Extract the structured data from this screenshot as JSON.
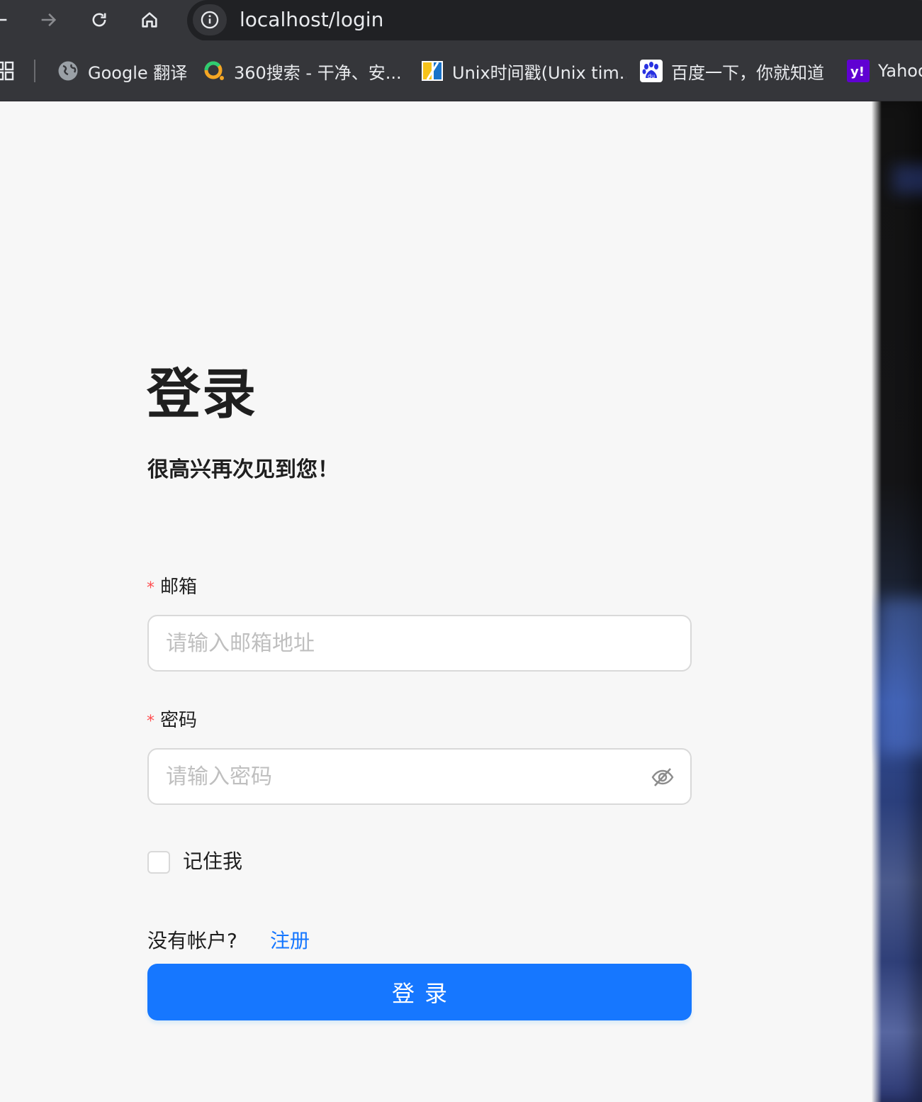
{
  "browser": {
    "url": "localhost/login",
    "bookmarks": [
      {
        "label": "Google 翻译",
        "icon": "globe-icon"
      },
      {
        "label": "360搜索 - 干净、安...",
        "icon": "360-search-icon"
      },
      {
        "label": "Unix时间戳(Unix tim...",
        "icon": "unix-timestamp-icon"
      },
      {
        "label": "百度一下，你就知道",
        "icon": "baidu-icon"
      },
      {
        "label": "Yahoo",
        "icon": "yahoo-icon"
      }
    ]
  },
  "login": {
    "title": "登录",
    "subtitle": "很高兴再次见到您！",
    "email": {
      "label": "邮箱",
      "required_mark": "*",
      "placeholder": "请输入邮箱地址",
      "value": ""
    },
    "password": {
      "label": "密码",
      "required_mark": "*",
      "placeholder": "请输入密码",
      "value": ""
    },
    "remember": {
      "label": "记住我",
      "checked": false
    },
    "no_account_text": "没有帐户?",
    "register_link": "注册",
    "submit_label": "登录"
  },
  "colors": {
    "primary": "#1677ff",
    "required": "#ff4d4f",
    "background": "#f7f7f7",
    "browser_chrome": "#35363a"
  }
}
